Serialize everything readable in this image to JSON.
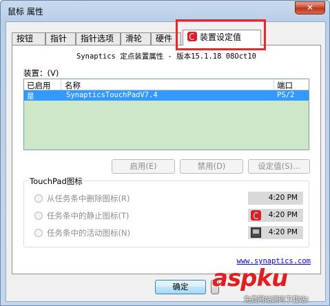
{
  "window": {
    "title": "鼠标 属性",
    "close_glyph": "✕"
  },
  "tabs": [
    {
      "label": "按钮"
    },
    {
      "label": "指针"
    },
    {
      "label": "指针选项"
    },
    {
      "label": "滑轮"
    },
    {
      "label": "硬件"
    },
    {
      "label": "装置设定值",
      "active": true
    }
  ],
  "panel": {
    "heading": "Synaptics 定点装置属性 - 版本15.1.18 08Oct10",
    "device_label": "装置：(V)",
    "table": {
      "columns": [
        "已启用",
        "名称",
        "端口"
      ],
      "rows": [
        {
          "enabled": "是",
          "name": "SynapticsTouchPadV7.4",
          "port": "PS/2",
          "selected": true
        }
      ]
    },
    "buttons": {
      "enable": "启用(E)",
      "disable": "禁用(D)",
      "settings": "设定值(S)..."
    },
    "group": {
      "title": "TouchPad图标",
      "options": [
        {
          "label": "从任务条中删除图标(R)",
          "preview_time": "4:20 PM",
          "preview_icon": "none"
        },
        {
          "label": "任务条中的静止图标(T)",
          "preview_time": "4:20 PM",
          "preview_icon": "synaptics-red-icon"
        },
        {
          "label": "任务条中的活动图标(N)",
          "preview_time": "4:20 PM",
          "preview_icon": "touchpad-icon"
        }
      ]
    },
    "link": "www.synaptics.com"
  },
  "footer": {
    "ok": "确定"
  },
  "watermark": {
    "text": "aspku",
    "sub": "免费网站源码下载站!"
  },
  "colors": {
    "selection": "#3399ff",
    "list_bg": "#cfe7c9",
    "highlight": "#e8262d"
  }
}
